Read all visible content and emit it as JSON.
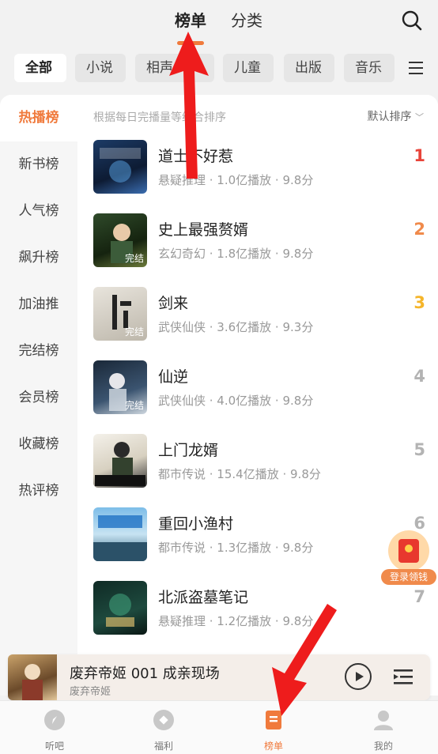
{
  "header": {
    "tabs": [
      {
        "label": "榜单",
        "active": true
      },
      {
        "label": "分类",
        "active": false
      }
    ],
    "search_icon": "search-icon"
  },
  "categories": [
    {
      "label": "全部",
      "active": true
    },
    {
      "label": "小说"
    },
    {
      "label": "相声"
    },
    {
      "label": "儿童"
    },
    {
      "label": "出版"
    },
    {
      "label": "音乐"
    }
  ],
  "sidebar": {
    "items": [
      {
        "label": "热播榜",
        "active": true
      },
      {
        "label": "新书榜"
      },
      {
        "label": "人气榜"
      },
      {
        "label": "飙升榜"
      },
      {
        "label": "加油推"
      },
      {
        "label": "完结榜"
      },
      {
        "label": "会员榜"
      },
      {
        "label": "收藏榜"
      },
      {
        "label": "热评榜"
      }
    ]
  },
  "list": {
    "hint": "根据每日完播量等综合排序",
    "sort_label": "默认排序",
    "books": [
      {
        "rank": "1",
        "title": "道士不好惹",
        "meta": "悬疑推理 · 1.0亿播放 · 9.8分",
        "finished": "",
        "rank_color": "#e8443a"
      },
      {
        "rank": "2",
        "title": "史上最强赘婿",
        "meta": "玄幻奇幻 · 1.8亿播放 · 9.8分",
        "finished": "完结",
        "rank_color": "#f08a4b"
      },
      {
        "rank": "3",
        "title": "剑来",
        "meta": "武侠仙侠 · 3.6亿播放 · 9.3分",
        "finished": "完结",
        "rank_color": "#f5b52a"
      },
      {
        "rank": "4",
        "title": "仙逆",
        "meta": "武侠仙侠 · 4.0亿播放 · 9.8分",
        "finished": "完结",
        "rank_color": "#b3b3b3"
      },
      {
        "rank": "5",
        "title": "上门龙婿",
        "meta": "都市传说 · 15.4亿播放 · 9.8分",
        "finished": "",
        "rank_color": "#b3b3b3"
      },
      {
        "rank": "6",
        "title": "重回小渔村",
        "meta": "都市传说 · 1.3亿播放 · 9.8分",
        "finished": "",
        "rank_color": "#b3b3b3"
      },
      {
        "rank": "7",
        "title": "北派盗墓笔记",
        "meta": "悬疑推理 · 1.2亿播放 · 9.8分",
        "finished": "",
        "rank_color": "#b3b3b3"
      }
    ]
  },
  "floating": {
    "label": "登录领钱"
  },
  "player": {
    "title": "废弃帝姬 001 成亲现场",
    "subtitle": "废弃帝姬"
  },
  "bottom_nav": [
    {
      "label": "听吧",
      "icon": "compass-icon"
    },
    {
      "label": "福利",
      "icon": "gift-icon"
    },
    {
      "label": "榜单",
      "icon": "ranking-icon",
      "active": true
    },
    {
      "label": "我的",
      "icon": "profile-icon"
    }
  ],
  "colors": {
    "accent": "#f07a3c",
    "arrow": "#ee1c1c"
  }
}
